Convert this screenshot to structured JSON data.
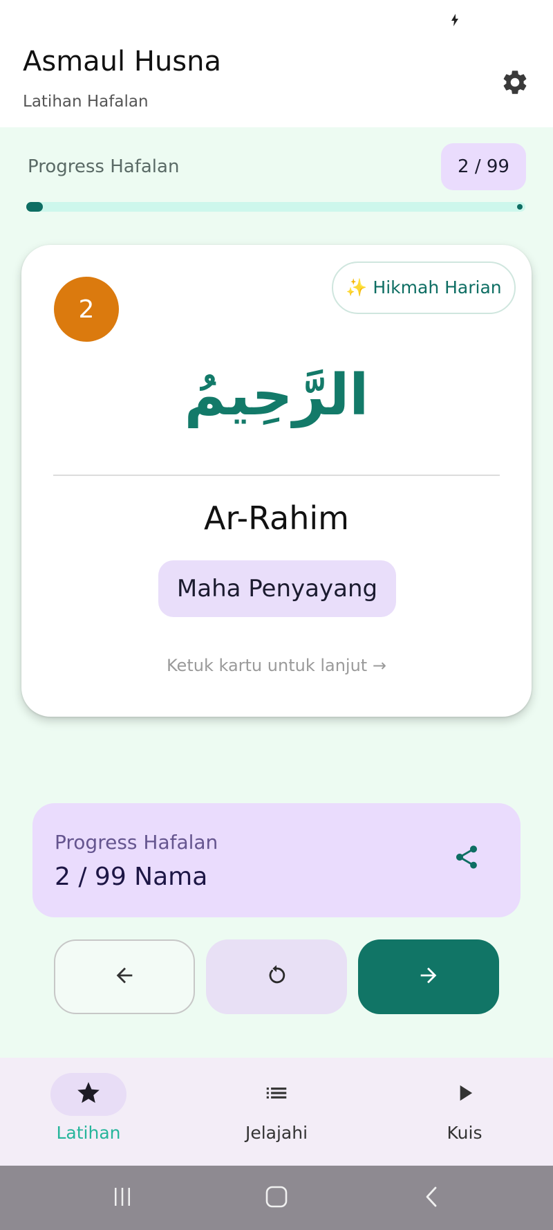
{
  "status_bar": {
    "icon": "charging-bolt-icon"
  },
  "app_bar": {
    "title": "Asmaul Husna",
    "subtitle": "Latihan Hafalan",
    "settings_icon": "gear-icon"
  },
  "progress": {
    "label": "Progress Hafalan",
    "count_text": "2 / 99",
    "current": 2,
    "total": 99
  },
  "card": {
    "number": "2",
    "hikmah_button": "✨ Hikmah Harian",
    "arabic": "الرَّحِيمُ",
    "latin": "Ar-Rahim",
    "meaning": "Maha Penyayang",
    "tap_hint": "Ketuk kartu untuk lanjut →"
  },
  "summary": {
    "label": "Progress Hafalan",
    "value": "2 / 99 Nama",
    "share_icon": "share-icon"
  },
  "controls": {
    "prev_icon": "arrow-left-icon",
    "reset_icon": "refresh-icon",
    "next_icon": "arrow-right-icon"
  },
  "bottom_nav": {
    "items": [
      {
        "label": "Latihan",
        "icon": "star-icon",
        "active": true
      },
      {
        "label": "Jelajahi",
        "icon": "list-icon",
        "active": false
      },
      {
        "label": "Kuis",
        "icon": "play-icon",
        "active": false
      }
    ]
  },
  "colors": {
    "primary": "#117566",
    "accent_orange": "#db7a0e",
    "lavender": "#eadcfd",
    "background": "#edfbf2",
    "active_nav_label": "#26b59b"
  }
}
